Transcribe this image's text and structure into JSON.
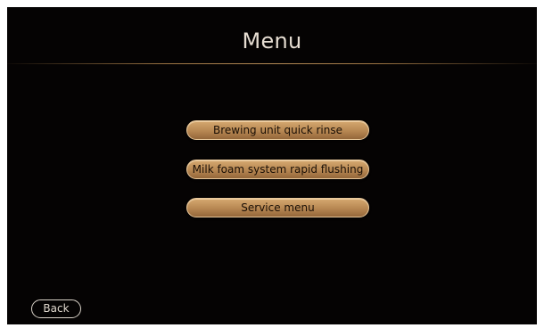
{
  "header": {
    "title": "Menu"
  },
  "menu": {
    "items": [
      {
        "label": "Brewing unit quick rinse"
      },
      {
        "label": "Milk foam system rapid flushing"
      },
      {
        "label": "Service menu"
      }
    ]
  },
  "footer": {
    "back_label": "Back"
  },
  "colors": {
    "background": "#050303",
    "button_gold": "#c4955f",
    "divider": "#9c7443",
    "title_text": "#e6ddd2"
  }
}
